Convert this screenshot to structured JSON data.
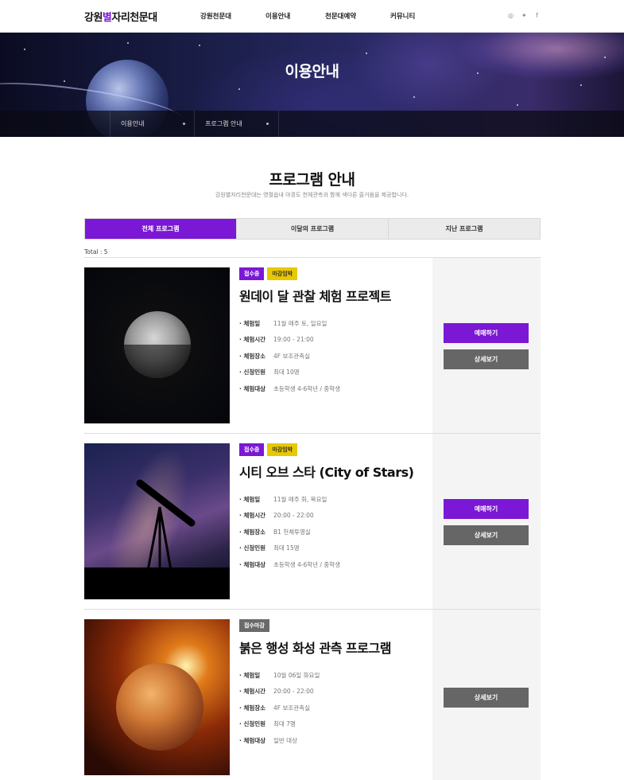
{
  "header": {
    "logo_pre": "강원",
    "logo_accent": "별",
    "logo_post": "자리천문대",
    "nav": [
      "강원천문대",
      "이용안내",
      "천문대예약",
      "커뮤니티"
    ],
    "social": [
      "instagram-icon",
      "twitter-icon",
      "facebook-icon"
    ]
  },
  "hero": {
    "title": "이용안내",
    "breadcrumb": [
      "이용안내",
      "프로그램 안내"
    ]
  },
  "section": {
    "title": "프로그램 안내",
    "subtitle": "강원별자리천문대는 영월읍내 야경도 천체관측과 함께 색다른 즐거움을 제공합니다."
  },
  "tabs": [
    "전체 프로그램",
    "이달의 프로그램",
    "지난 프로그램"
  ],
  "active_tab": "전체 프로그램",
  "total": "Total : 5",
  "labels": {
    "date": "체험일",
    "time": "체험시간",
    "place": "체험장소",
    "capacity": "신청인원",
    "target": "체험대상",
    "reserve": "예매하기",
    "detail": "상세보기"
  },
  "programs": [
    {
      "badges": [
        "접수중",
        "마감임박"
      ],
      "title": "원데이 달 관찰 체험 프로젝트",
      "date": "11월 매주 토, 일요일",
      "time": "19:00 - 21:00",
      "place": "4F 보조관측실",
      "capacity": "최대 10명",
      "target": "초등학생 4-6학년 / 중학생"
    },
    {
      "badges": [
        "접수중",
        "마감임박"
      ],
      "title": "시티 오브 스타 (City of Stars)",
      "date": "11월 매주 화, 목요일",
      "time": "20:00 - 22:00",
      "place": "B1 천체투영실",
      "capacity": "최대 15명",
      "target": "초등학생 4-6학년 / 중학생"
    },
    {
      "badges": [
        "접수마감"
      ],
      "title": "붉은 행성 화성 관측 프로그램",
      "date": "10월 06일 화요일",
      "time": "20:00 - 22:00",
      "place": "4F 보조관측실",
      "capacity": "최대 7명",
      "target": "일반 대상"
    }
  ],
  "colors": {
    "accent": "#7b18d6",
    "soon": "#e8c800",
    "closed": "#6a6a6a",
    "button_gray": "#666666"
  }
}
